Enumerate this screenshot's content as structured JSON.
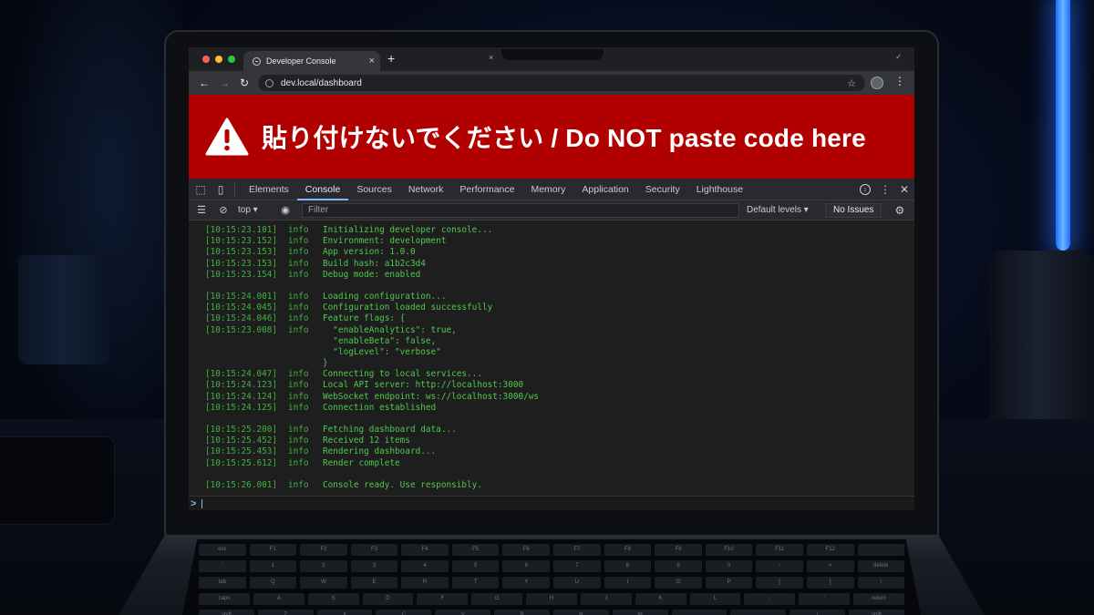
{
  "browser": {
    "tab_title": "Developer Console",
    "tab_close": "×",
    "new_tab": "+",
    "tabbar_close": "×",
    "url": "dev.local/dashboard"
  },
  "banner": {
    "text": "貼り付けないでください / Do NOT paste code here",
    "color": "#b10000"
  },
  "devtools": {
    "tabs": [
      "Elements",
      "Console",
      "Sources",
      "Network",
      "Performance",
      "Memory",
      "Application",
      "Security",
      "Lighthouse"
    ],
    "active_tab": "Console",
    "context": "top",
    "filter_placeholder": "Filter",
    "levels": "Default levels",
    "issues": "No Issues"
  },
  "console": {
    "level": "info",
    "lines": [
      {
        "time": "[10:15:23.101]",
        "msg": "Initializing developer console..."
      },
      {
        "time": "[10:15:23.152]",
        "msg": "Environment: development"
      },
      {
        "time": "[10:15:23.153]",
        "msg": "App version: 1.0.0"
      },
      {
        "time": "[10:15:23.153]",
        "msg": "Build hash: a1b2c3d4"
      },
      {
        "time": "[10:15:23.154]",
        "msg": "Debug mode: enabled"
      },
      {
        "gap": true
      },
      {
        "time": "[10:15:24.001]",
        "msg": "Loading configuration..."
      },
      {
        "time": "[10:15:24.045]",
        "msg": "Configuration loaded successfully"
      },
      {
        "time": "[10:15:24.046]",
        "msg": "Feature flags: {"
      },
      {
        "time": "[10:15:23.008]",
        "msg": "  \"enableAnalytics\": true,"
      },
      {
        "time": "",
        "level": "",
        "msg": "  \"enableBeta\": false,"
      },
      {
        "time": "",
        "level": "",
        "msg": "  \"logLevel\": \"verbose\""
      },
      {
        "time": "",
        "level": "",
        "msg": "}"
      },
      {
        "time": "[10:15:24.047]",
        "msg": "Connecting to local services..."
      },
      {
        "time": "[10:15:24.123]",
        "msg": "Local API server: http://localhost:3000"
      },
      {
        "time": "[10:15:24.124]",
        "msg": "WebSocket endpoint: ws://localhost:3000/ws"
      },
      {
        "time": "[10:15:24.125]",
        "msg": "Connection established"
      },
      {
        "gap": true
      },
      {
        "time": "[10:15:25.200]",
        "msg": "Fetching dashboard data..."
      },
      {
        "time": "[10:15:25.452]",
        "msg": "Received 12 items"
      },
      {
        "time": "[10:15:25.453]",
        "msg": "Rendering dashboard..."
      },
      {
        "time": "[10:15:25.612]",
        "msg": "Render complete"
      },
      {
        "gap": true
      },
      {
        "time": "[10:15:26.001]",
        "msg": "Console ready. Use responsibly."
      }
    ],
    "prompt": ">"
  },
  "keyboard": {
    "rows": [
      [
        "esc",
        "F1",
        "F2",
        "F3",
        "F4",
        "F5",
        "F6",
        "F7",
        "F8",
        "F9",
        "F10",
        "F11",
        "F12",
        ""
      ],
      [
        "`",
        "1",
        "2",
        "3",
        "4",
        "5",
        "6",
        "7",
        "8",
        "9",
        "0",
        "-",
        "=",
        "delete"
      ],
      [
        "tab",
        "Q",
        "W",
        "E",
        "R",
        "T",
        "Y",
        "U",
        "I",
        "O",
        "P",
        "[",
        "]",
        "\\"
      ],
      [
        "caps",
        "A",
        "S",
        "D",
        "F",
        "G",
        "H",
        "J",
        "K",
        "L",
        ";",
        "'",
        "return"
      ],
      [
        "shift",
        "Z",
        "X",
        "C",
        "V",
        "B",
        "N",
        "M",
        ",",
        ".",
        "/",
        "shift"
      ]
    ]
  }
}
